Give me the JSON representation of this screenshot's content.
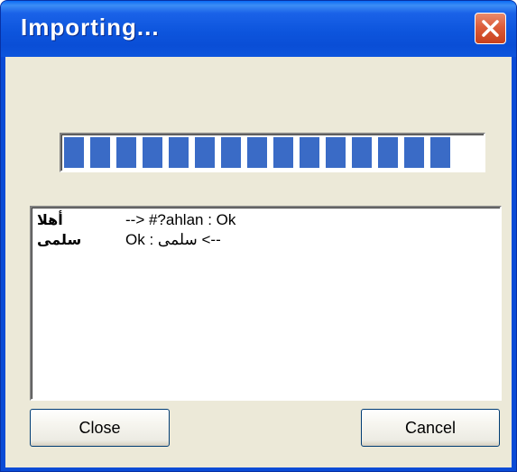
{
  "window": {
    "title": "Importing...",
    "close_icon": "close-x-icon"
  },
  "progress": {
    "value_percent": 100,
    "block_count": 15
  },
  "log": {
    "lines": [
      {
        "source": "أهلا",
        "result": "--> #?ahlan : Ok"
      },
      {
        "source": "سلمى",
        "result": "--> سلمى : Ok"
      }
    ]
  },
  "buttons": {
    "close_label": "Close",
    "cancel_label": "Cancel"
  }
}
